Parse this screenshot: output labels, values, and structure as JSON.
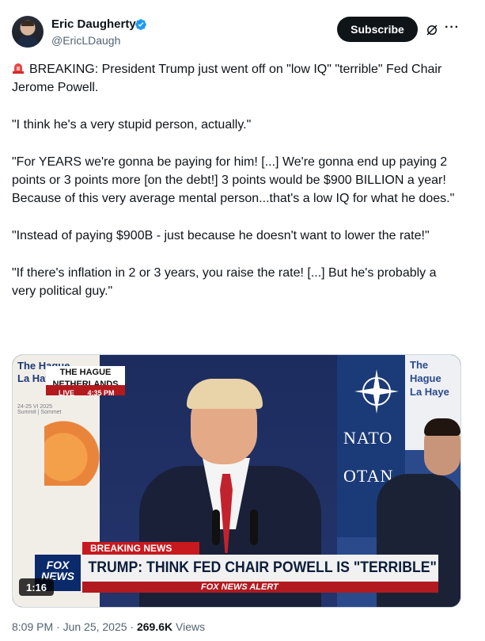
{
  "author": {
    "name": "Eric Daugherty",
    "handle": "@EricLDaugh"
  },
  "actions": {
    "subscribe_label": "Subscribe",
    "more_label": "···"
  },
  "tweet": {
    "paragraphs": [
      "BREAKING: President Trump just went off on \"low IQ\" \"terrible\" Fed Chair Jerome Powell.",
      "\"I think he's a very stupid person, actually.\"",
      "\"For YEARS we're gonna be paying for him! [...] We're gonna end up paying 2 points or 3 points more [on the debt!] 3 points would be $900 BILLION a year! Because of this very average mental person...that's a low IQ for what he does.\"",
      "\"Instead of paying $900B - just because he doesn't want to lower the rate!\"",
      "\"If there's inflation in 2 or 3 years, you raise the rate! [...] But he's probably a very political guy.\""
    ]
  },
  "media": {
    "location_line1": "THE HAGUE",
    "location_line2": "NETHERLANDS",
    "live_label": "LIVE",
    "live_time": "4:35 PM",
    "left_sign": "The Hague\nLa Haye",
    "left_sign_dates": "24-25 VI 2025\nSummit | Sommet",
    "right_sign": "The Hague\nLa Haye",
    "nato": "NATO",
    "otan": "OTAN",
    "breaking_label": "BREAKING NEWS",
    "headline": "TRUMP: THINK FED CHAIR POWELL IS \"TERRIBLE\"",
    "alert": "FOX NEWS ALERT",
    "network": "FOX NEWS",
    "duration": "1:16"
  },
  "footer": {
    "time": "8:09 PM · Jun 25, 2025 · ",
    "views_count": "269.6K",
    "views_label": " Views"
  },
  "colors": {
    "accent": "#1d9bf0",
    "fox_red": "#c8191e",
    "fox_blue": "#0b2a6b",
    "nato_blue": "#1b3a78"
  },
  "icons": [
    "siren-icon",
    "verified-badge-icon",
    "grok-icon",
    "more-icon"
  ]
}
